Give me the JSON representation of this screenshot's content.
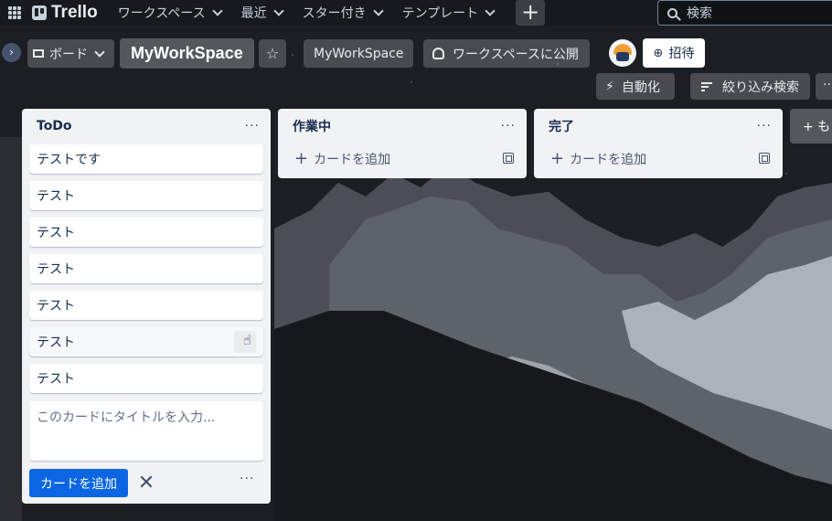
{
  "topbar": {
    "app_name": "Trello",
    "nav": [
      "ワークスペース",
      "最近",
      "スター付き",
      "テンプレート"
    ],
    "create_label": "+",
    "search_placeholder": "検索"
  },
  "board_header": {
    "view_label": "ボード",
    "board_title": "MyWorkSpace",
    "workspace_label": "MyWorkSpace",
    "visibility_label": "ワークスペースに公開",
    "invite_label": "招待",
    "automation_label": "自動化",
    "filter_label": "絞り込み検索",
    "more_label": "···"
  },
  "lists": [
    {
      "title": "ToDo",
      "cards": [
        "テストです",
        "テスト",
        "テスト",
        "テスト",
        "テスト",
        "テスト",
        "テスト"
      ],
      "composer_placeholder": "このカードにタイトルを入力...",
      "add_button": "カードを追加",
      "menu": "···"
    },
    {
      "title": "作業中",
      "add_card": "カードを追加",
      "menu": "···"
    },
    {
      "title": "完了",
      "add_card": "カードを追加",
      "menu": "···"
    }
  ],
  "add_list_label": "+ も",
  "colors": {
    "primary_button": "#0c66e4",
    "list_background": "#f1f2f4",
    "text": "#172b4d"
  }
}
